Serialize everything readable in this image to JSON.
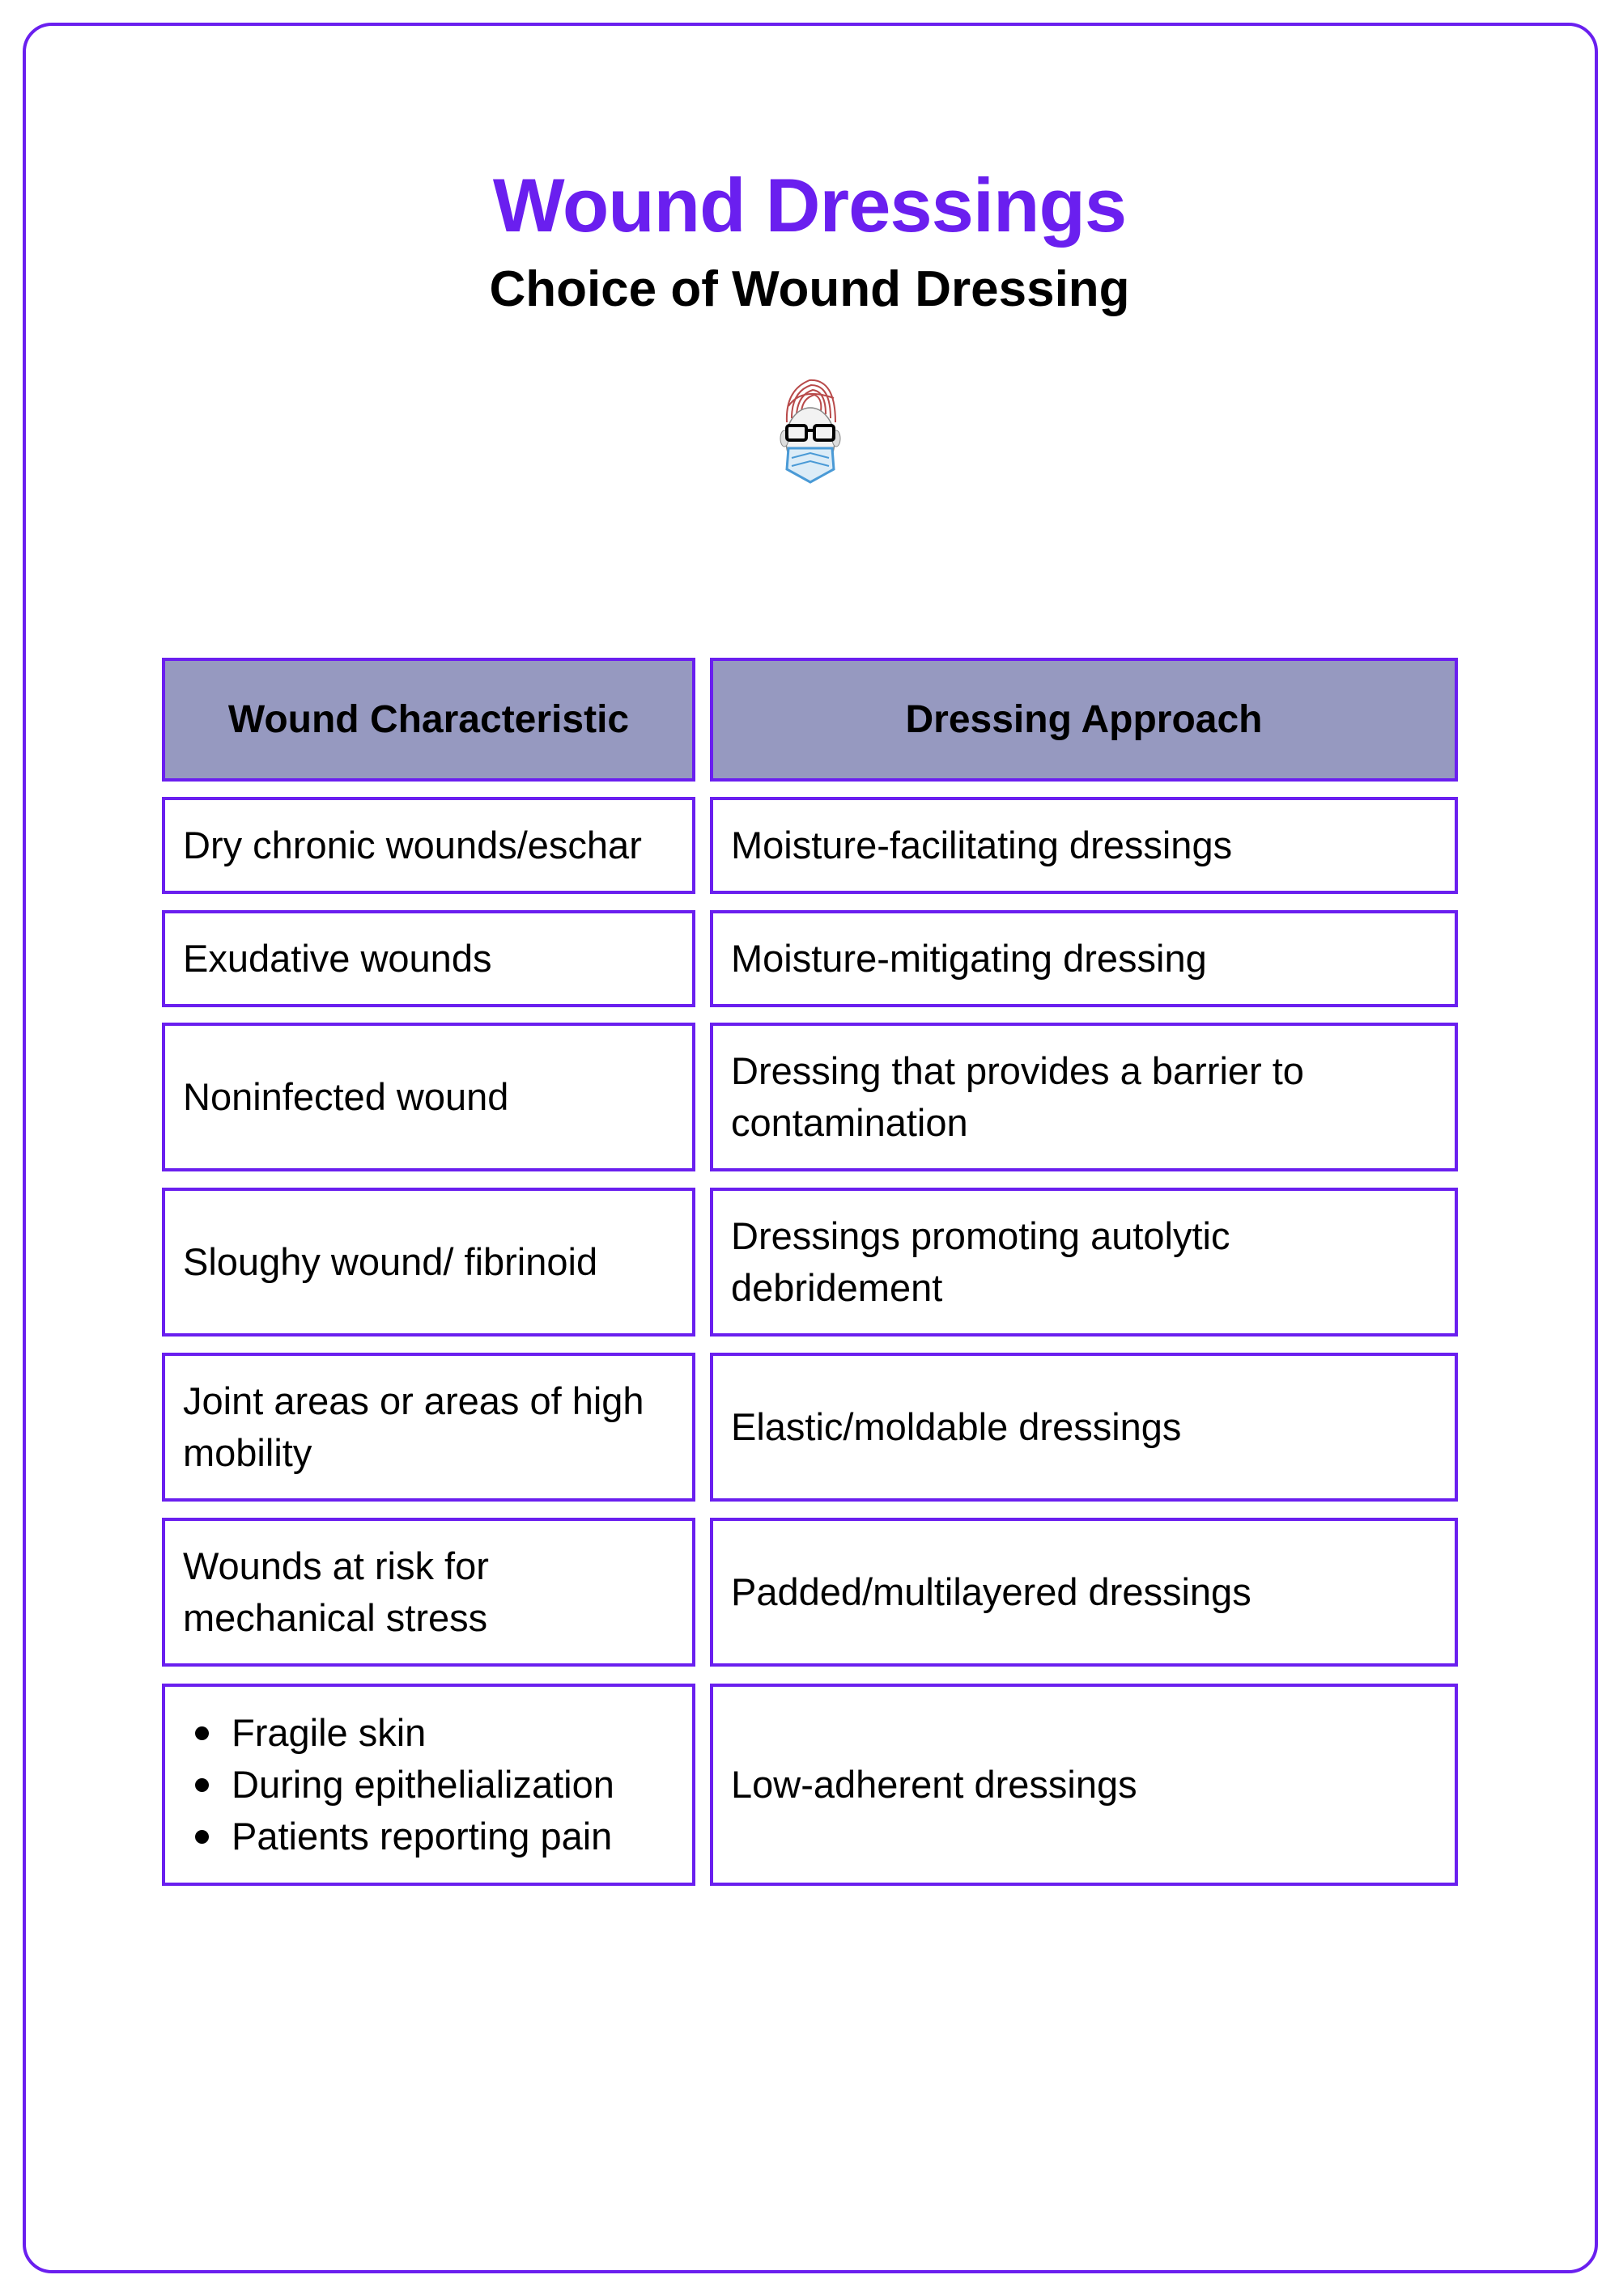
{
  "header": {
    "title": "Wound Dressings",
    "subtitle": "Choice of Wound Dressing",
    "logo_icon": "masked-doctor-avatar-icon"
  },
  "colors": {
    "accent": "#6a1fef",
    "header_fill": "#9699c0"
  },
  "table": {
    "columns": [
      "Wound Characteristic",
      "Dressing Approach"
    ],
    "rows": [
      {
        "characteristic": "Dry chronic wounds/eschar",
        "approach": "Moisture-facilitating dressings"
      },
      {
        "characteristic": "Exudative wounds",
        "approach": "Moisture-mitigating dressing"
      },
      {
        "characteristic": "Noninfected wound",
        "approach": "Dressing that provides a barrier to contamination"
      },
      {
        "characteristic": "Sloughy wound/ fibrinoid",
        "approach": "Dressings promoting autolytic debridement"
      },
      {
        "characteristic": "Joint areas or areas of high mobility",
        "approach": "Elastic/moldable dressings"
      },
      {
        "characteristic": "Wounds at risk for mechanical stress",
        "approach": "Padded/multilayered dressings"
      },
      {
        "characteristic_list": [
          "Fragile skin",
          "During epithelialization",
          "Patients reporting pain"
        ],
        "approach": "Low-adherent dressings"
      }
    ]
  }
}
